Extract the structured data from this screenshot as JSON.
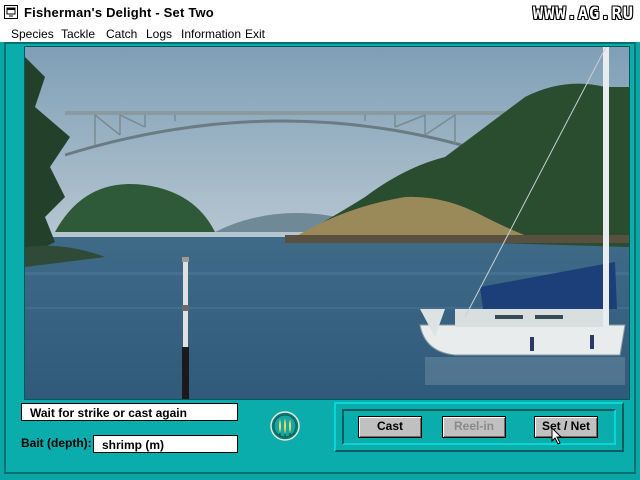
{
  "window": {
    "title": "Fisherman's Delight - Set Two",
    "watermark": "WWW.AG.RU"
  },
  "menu": [
    "Species",
    "Tackle",
    "Catch",
    "Logs",
    "Information",
    "Exit"
  ],
  "status": {
    "message": "Wait for strike or cast again",
    "bait_label": "Bait (depth):",
    "bait_value": "shrimp (m)"
  },
  "buttons": {
    "cast": "Cast",
    "reel_in": "Reel-in",
    "set_net": "Set / Net"
  },
  "button_states": {
    "reel_in_enabled": false
  },
  "colors": {
    "background": "#0aa6a6",
    "title_bar": "#ffffff"
  },
  "icons": {
    "system_menu": "system-menu-icon",
    "fish_badge": "fish-emblem-icon",
    "cursor": "mouse-pointer-icon"
  }
}
